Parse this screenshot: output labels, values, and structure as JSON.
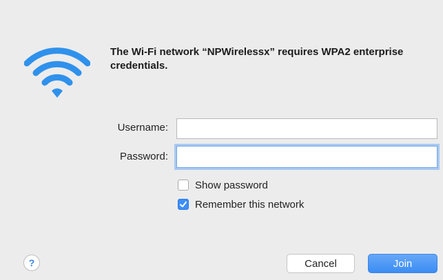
{
  "dialog": {
    "message": "The Wi-Fi network “NPWirelessx” requires WPA2 enterprise credentials.",
    "wifi_icon": "wifi-icon",
    "accent_color": "#3d8ff6"
  },
  "form": {
    "username_label": "Username:",
    "username_value": "",
    "password_label": "Password:",
    "password_value": "",
    "show_password_label": "Show password",
    "show_password_checked": false,
    "remember_label": "Remember this network",
    "remember_checked": true
  },
  "buttons": {
    "help_label": "?",
    "cancel_label": "Cancel",
    "join_label": "Join"
  }
}
